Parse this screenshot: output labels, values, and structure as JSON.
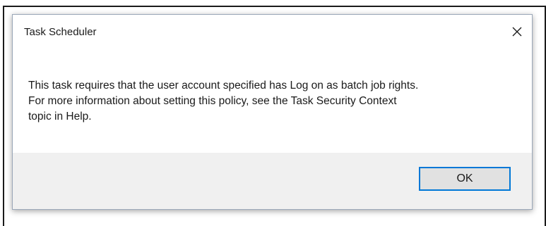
{
  "dialog": {
    "title": "Task Scheduler",
    "close_icon": "close-icon",
    "message_lines": [
      "This task requires that the user account specified has Log on as batch job rights.",
      "For more information about setting this policy, see the Task Security Context",
      "topic in Help."
    ],
    "ok_label": "OK"
  },
  "colors": {
    "accent": "#0078d7",
    "footer_bg": "#f0f0f0"
  }
}
